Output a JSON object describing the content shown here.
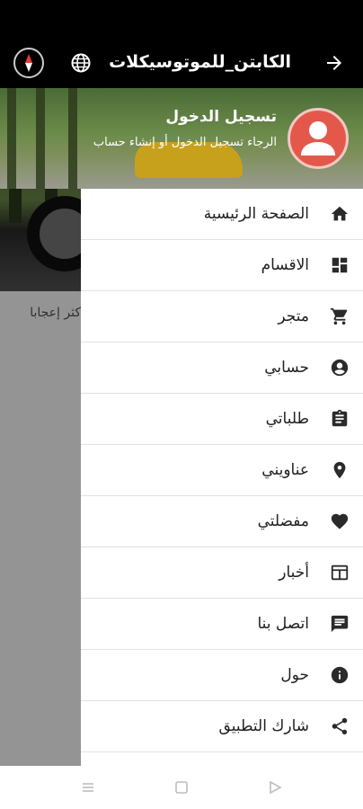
{
  "app_bar": {
    "title": "الكابتن_للموتوسيكلات",
    "back_icon": "arrow-right-icon",
    "globe_icon": "globe-icon",
    "compass_icon": "compass-icon"
  },
  "background": {
    "caption": "كثر إعجابا"
  },
  "drawer": {
    "header": {
      "title": "تسجيل الدخول",
      "subtitle": "الرجاء تسجيل الدخول أو إنشاء حساب",
      "avatar_color": "#e4584c"
    },
    "items": [
      {
        "label": "الصفحة الرئيسية",
        "icon": "home-icon"
      },
      {
        "label": "الاقسام",
        "icon": "dashboard-icon"
      },
      {
        "label": "متجر",
        "icon": "cart-icon"
      },
      {
        "label": "حسابي",
        "icon": "account-icon"
      },
      {
        "label": "طلباتي",
        "icon": "clipboard-icon"
      },
      {
        "label": "عناويني",
        "icon": "location-pin-icon"
      },
      {
        "label": "مفضلتي",
        "icon": "heart-icon"
      },
      {
        "label": "أخبار",
        "icon": "news-icon"
      },
      {
        "label": "اتصل بنا",
        "icon": "chat-icon"
      },
      {
        "label": "حول",
        "icon": "info-icon"
      },
      {
        "label": "شارك التطبيق",
        "icon": "share-icon"
      }
    ]
  },
  "nav_bar": {
    "back": "nav-back-icon",
    "home": "nav-home-icon",
    "recents": "nav-recents-icon"
  },
  "colors": {
    "app_bar": "#000000",
    "accent": "#e4584c",
    "icon": "#2a2a2a"
  }
}
